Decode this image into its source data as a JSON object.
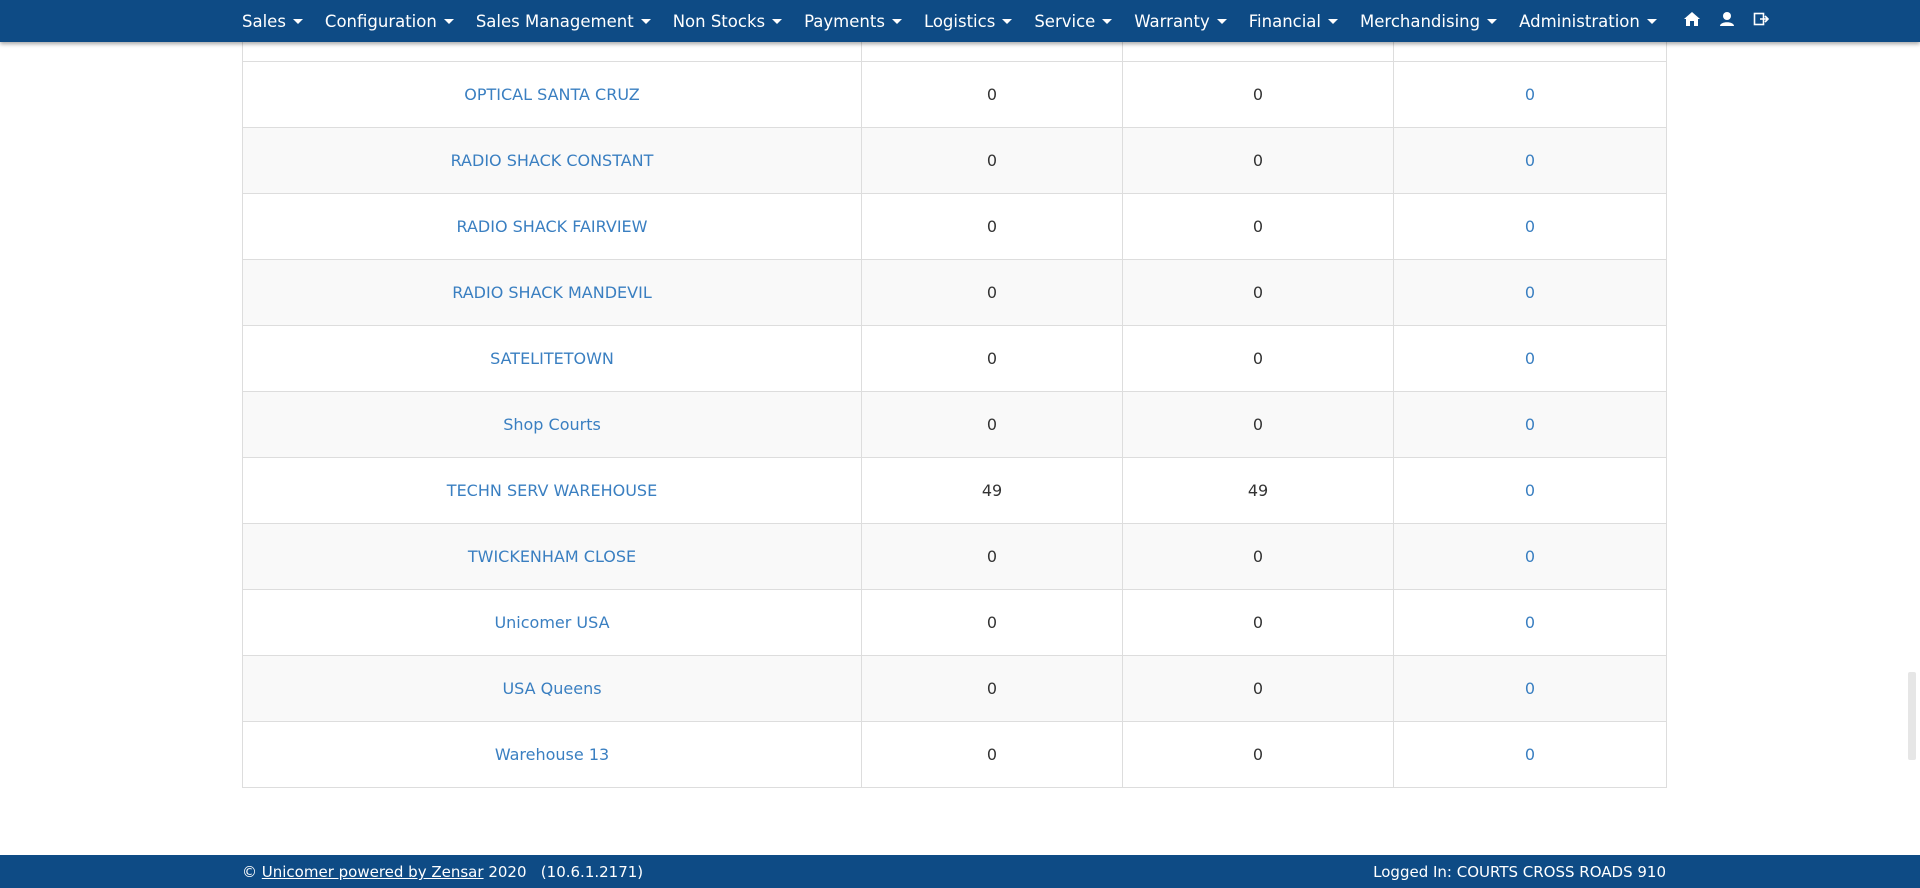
{
  "nav": {
    "items": [
      {
        "label": "Sales"
      },
      {
        "label": "Configuration"
      },
      {
        "label": "Sales Management"
      },
      {
        "label": "Non Stocks"
      },
      {
        "label": "Payments"
      },
      {
        "label": "Logistics"
      },
      {
        "label": "Service"
      },
      {
        "label": "Warranty"
      },
      {
        "label": "Financial"
      },
      {
        "label": "Merchandising"
      },
      {
        "label": "Administration"
      }
    ],
    "icons": [
      "home-icon",
      "user-icon",
      "logout-icon"
    ]
  },
  "table": {
    "rows": [
      {
        "name": "OPTICAL SANTA CRUZ",
        "c1": "0",
        "c2": "0",
        "c3": "0"
      },
      {
        "name": "RADIO SHACK CONSTANT",
        "c1": "0",
        "c2": "0",
        "c3": "0"
      },
      {
        "name": "RADIO SHACK FAIRVIEW",
        "c1": "0",
        "c2": "0",
        "c3": "0"
      },
      {
        "name": "RADIO SHACK MANDEVIL",
        "c1": "0",
        "c2": "0",
        "c3": "0"
      },
      {
        "name": "SATELITETOWN",
        "c1": "0",
        "c2": "0",
        "c3": "0"
      },
      {
        "name": "Shop Courts",
        "c1": "0",
        "c2": "0",
        "c3": "0"
      },
      {
        "name": "TECHN SERV WAREHOUSE",
        "c1": "49",
        "c2": "49",
        "c3": "0"
      },
      {
        "name": "TWICKENHAM CLOSE",
        "c1": "0",
        "c2": "0",
        "c3": "0"
      },
      {
        "name": "Unicomer USA",
        "c1": "0",
        "c2": "0",
        "c3": "0"
      },
      {
        "name": "USA Queens",
        "c1": "0",
        "c2": "0",
        "c3": "0"
      },
      {
        "name": "Warehouse 13",
        "c1": "0",
        "c2": "0",
        "c3": "0"
      }
    ]
  },
  "footer": {
    "copyright": "©",
    "link": "Unicomer powered by Zensar",
    "year_version": "2020   (10.6.1.2171)",
    "logged_in": "Logged In: COURTS CROSS ROADS 910"
  },
  "colors": {
    "brand": "#0e4b85",
    "link": "#3a7fc1"
  }
}
